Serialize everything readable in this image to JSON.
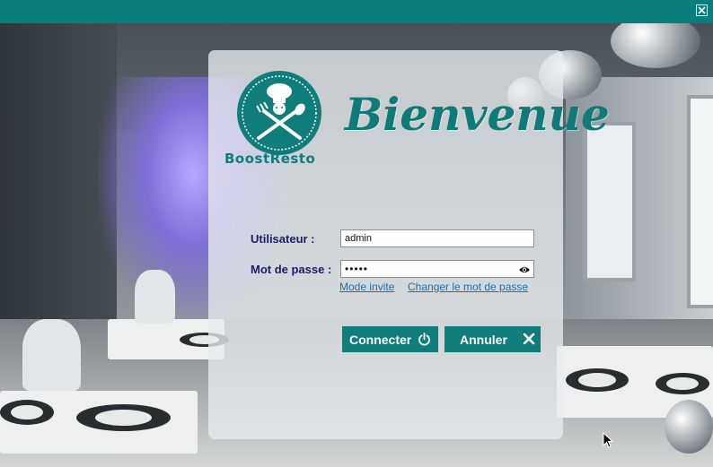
{
  "window": {
    "close_icon": "close-icon"
  },
  "header": {
    "welcome_title": "Bienvenue",
    "logo_text": "BoostResto"
  },
  "form": {
    "user_label": "Utilisateur :",
    "user_value": "admin",
    "password_label": "Mot de passe :",
    "password_value": "•••••",
    "show_password_icon": "eye-icon"
  },
  "links": {
    "guest_mode": "Mode invite",
    "change_password": "Changer le mot de passe"
  },
  "buttons": {
    "connect_label": "Connecter",
    "connect_icon": "power-icon",
    "cancel_label": "Annuler",
    "cancel_icon": "x-icon"
  },
  "colors": {
    "accent": "#0f7d7a",
    "title_bar": "#0a7d7d",
    "label_text": "#1b1d6a",
    "link": "#1f6fa8"
  }
}
